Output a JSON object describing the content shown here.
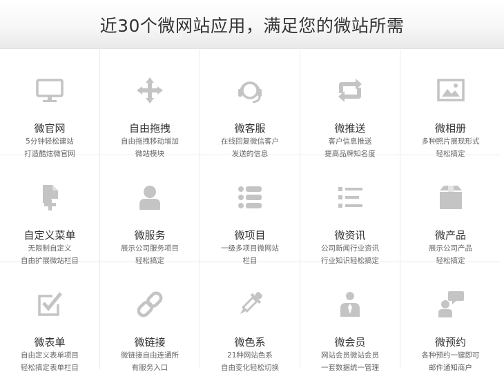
{
  "header": {
    "title": "近30个微网站应用，满足您的微站所需"
  },
  "items": [
    {
      "name": "微官网",
      "desc1": "5分钟轻松建站",
      "desc2": "打造酷炫微官网",
      "icon": "monitor-icon"
    },
    {
      "name": "自由拖拽",
      "desc1": "自由拖拽移动增加",
      "desc2": "微站模块",
      "icon": "move-arrows-icon"
    },
    {
      "name": "微客服",
      "desc1": "在线回复微信客户",
      "desc2": "发送的信息",
      "icon": "headset-icon"
    },
    {
      "name": "微推送",
      "desc1": "客户信息推送",
      "desc2": "提高品牌知名度",
      "icon": "refresh-arrows-icon"
    },
    {
      "name": "微相册",
      "desc1": "多种照片展现形式",
      "desc2": "轻松搞定",
      "icon": "image-icon"
    },
    {
      "name": "自定义菜单",
      "desc1": "无限制自定义",
      "desc2": "自由扩展微站栏目",
      "icon": "add-document-icon"
    },
    {
      "name": "微服务",
      "desc1": "展示公司服务项目",
      "desc2": "轻松搞定",
      "icon": "user-icon"
    },
    {
      "name": "微项目",
      "desc1": "一级多项目微网站",
      "desc2": "栏目",
      "icon": "list-icon"
    },
    {
      "name": "微资讯",
      "desc1": "公司新闻行业资讯",
      "desc2": "行业知识轻松搞定",
      "icon": "news-list-icon"
    },
    {
      "name": "微产品",
      "desc1": "展示公司产品",
      "desc2": "轻松搞定",
      "icon": "box-icon"
    },
    {
      "name": "微表单",
      "desc1": "自由定义表单项目",
      "desc2": "轻松搞定表单栏目",
      "icon": "checkbox-icon"
    },
    {
      "name": "微链接",
      "desc1": "微链接自由连通所",
      "desc2": "有服务入口",
      "icon": "link-icon"
    },
    {
      "name": "微色系",
      "desc1": "21种网站色系",
      "desc2": "自由变化轻松切换",
      "icon": "eyedropper-icon"
    },
    {
      "name": "微会员",
      "desc1": "网站会员微站会员",
      "desc2": "一套数据统一管理",
      "icon": "member-icon"
    },
    {
      "name": "微预约",
      "desc1": "各种预约一键即可",
      "desc2": "邮件通知商户",
      "icon": "chat-user-icon"
    }
  ]
}
